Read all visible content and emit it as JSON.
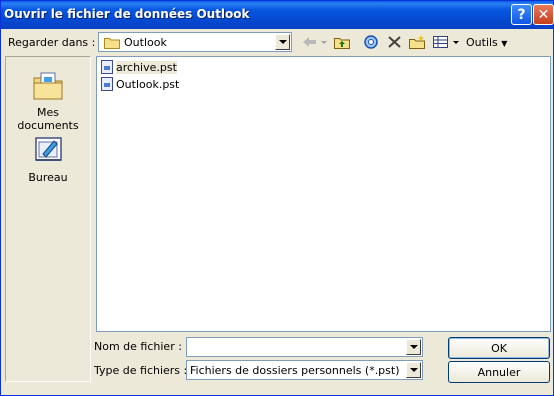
{
  "window": {
    "title": "Ouvrir le fichier de données Outlook"
  },
  "titlebar": {
    "help_glyph": "?",
    "close_glyph": "✕"
  },
  "toolbar": {
    "look_in_label": "Regarder dans :",
    "look_in_value": "Outlook",
    "tools_label": "Outils"
  },
  "places": [
    {
      "label": "Mes documents",
      "icon": "my-documents-icon"
    },
    {
      "label": "Bureau",
      "icon": "desktop-icon"
    }
  ],
  "files": [
    {
      "name": "archive.pst",
      "selected": true
    },
    {
      "name": "Outlook.pst",
      "selected": false
    }
  ],
  "form": {
    "filename_label": "Nom de fichier :",
    "filename_value": "",
    "filetype_label": "Type de fichiers :",
    "filetype_value": "Fichiers de dossiers personnels (*.pst)"
  },
  "buttons": {
    "ok": "OK",
    "cancel": "Annuler"
  }
}
